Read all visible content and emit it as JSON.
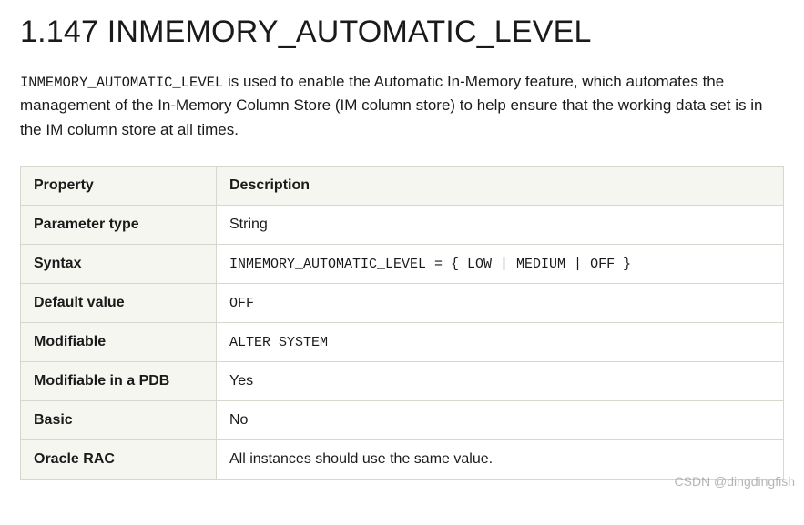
{
  "heading": "1.147 INMEMORY_AUTOMATIC_LEVEL",
  "intro": {
    "code": "INMEMORY_AUTOMATIC_LEVEL",
    "rest": " is used to enable the Automatic In-Memory feature, which automates the management of the In-Memory Column Store (IM column store) to help ensure that the working data set is in the IM column store at all times."
  },
  "table": {
    "header": {
      "col1": "Property",
      "col2": "Description"
    },
    "rows": [
      {
        "property": "Parameter type",
        "value": "String",
        "mono": false
      },
      {
        "property": "Syntax",
        "value": "INMEMORY_AUTOMATIC_LEVEL = { LOW | MEDIUM | OFF }",
        "mono": true
      },
      {
        "property": "Default value",
        "value": "OFF",
        "mono": true
      },
      {
        "property": "Modifiable",
        "value": "ALTER SYSTEM",
        "mono": true
      },
      {
        "property": "Modifiable in a PDB",
        "value": "Yes",
        "mono": false
      },
      {
        "property": "Basic",
        "value": "No",
        "mono": false
      },
      {
        "property": "Oracle RAC",
        "value": "All instances should use the same value.",
        "mono": false
      }
    ]
  },
  "watermark": "CSDN @dingdingfish"
}
